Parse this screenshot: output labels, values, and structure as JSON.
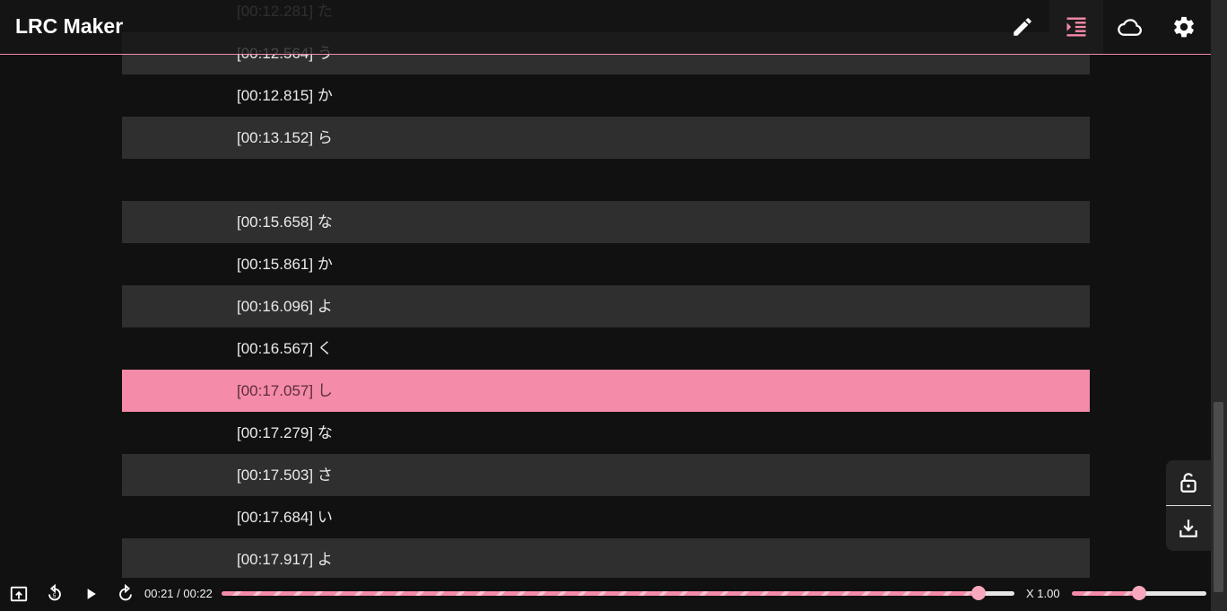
{
  "app": {
    "title": "LRC Maker"
  },
  "header": {
    "buttons": [
      {
        "name": "edit-button",
        "icon": "pencil-icon",
        "active": false
      },
      {
        "name": "synchronizer-button",
        "icon": "format-indent-icon",
        "active": true
      },
      {
        "name": "cloud-button",
        "icon": "cloud-icon",
        "active": false
      },
      {
        "name": "settings-button",
        "icon": "gear-icon",
        "active": false
      }
    ]
  },
  "lyrics": {
    "current_index": 9,
    "lines": [
      {
        "time": "[00:12.281]",
        "text": "た"
      },
      {
        "time": "[00:12.564]",
        "text": "う"
      },
      {
        "time": "[00:12.815]",
        "text": "か"
      },
      {
        "time": "[00:13.152]",
        "text": "ら"
      },
      {
        "time": "",
        "text": ""
      },
      {
        "time": "[00:15.658]",
        "text": "な"
      },
      {
        "time": "[00:15.861]",
        "text": "か"
      },
      {
        "time": "[00:16.096]",
        "text": "よ"
      },
      {
        "time": "[00:16.567]",
        "text": "く"
      },
      {
        "time": "[00:17.057]",
        "text": "し"
      },
      {
        "time": "[00:17.279]",
        "text": "な"
      },
      {
        "time": "[00:17.503]",
        "text": "さ"
      },
      {
        "time": "[00:17.684]",
        "text": "い"
      },
      {
        "time": "[00:17.917]",
        "text": "よ"
      }
    ]
  },
  "side_panel": {
    "lock_icon": "lock-open-icon",
    "download_icon": "download-icon"
  },
  "player": {
    "time_display": "00:21 / 00:22",
    "progress_fraction": 0.955,
    "rate_label": "X 1.00",
    "volume_fraction": 0.5
  },
  "colors": {
    "accent": "#f48ba8",
    "background": "#111111",
    "row_alt": "#2f2f2f"
  }
}
